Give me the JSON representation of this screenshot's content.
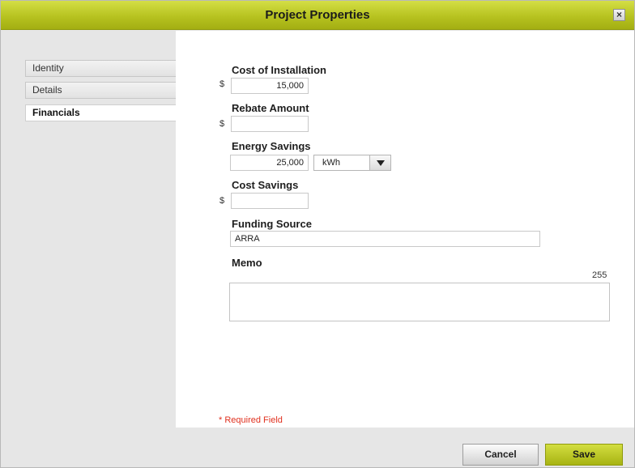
{
  "dialog": {
    "title": "Project Properties",
    "close_label": "×"
  },
  "sidebar": {
    "items": [
      {
        "label": "Identity"
      },
      {
        "label": "Details"
      },
      {
        "label": "Financials",
        "active": true
      }
    ]
  },
  "form": {
    "cost_of_installation": {
      "label": "Cost of Installation",
      "currency": "$",
      "value": "15,000"
    },
    "rebate_amount": {
      "label": "Rebate Amount",
      "currency": "$",
      "value": ""
    },
    "energy_savings": {
      "label": "Energy Savings",
      "value": "25,000",
      "unit": "kWh"
    },
    "cost_savings": {
      "label": "Cost Savings",
      "currency": "$",
      "value": ""
    },
    "funding_source": {
      "label": "Funding Source",
      "value": "ARRA"
    },
    "memo": {
      "label": "Memo",
      "remaining_chars": "255",
      "value": ""
    },
    "required_note": "* Required Field"
  },
  "footer": {
    "cancel_label": "Cancel",
    "save_label": "Save"
  },
  "colors": {
    "accent": "#b7c320",
    "required": "#e0301e"
  }
}
